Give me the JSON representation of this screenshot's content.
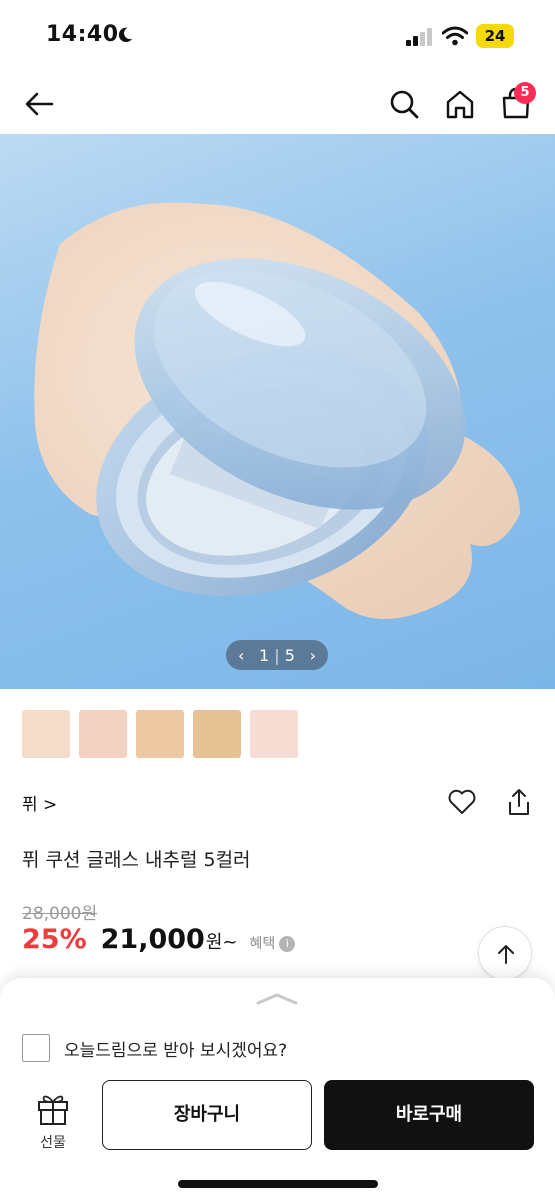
{
  "status_bar": {
    "time": "14:40",
    "battery": "24",
    "icons": [
      "moon-icon",
      "signal-icon",
      "wifi-icon",
      "battery-icon"
    ]
  },
  "nav": {
    "icons": [
      "back-arrow-icon",
      "search-icon",
      "home-icon",
      "shopping-bag-icon"
    ],
    "cart_count": "5"
  },
  "gallery": {
    "current": "1",
    "divider": "|",
    "total": "5",
    "prev_icon": "chevron-left-icon",
    "next_icon": "chevron-right-icon",
    "swatch_colors": [
      "#f4dcc9",
      "#f3d2c2",
      "#ecc9a2",
      "#e6c193",
      "#f6dcd3"
    ]
  },
  "product": {
    "brand": "퓌 >",
    "title": "퓌 쿠션 글래스 내추럴 5컬러",
    "original_price": "28,000원",
    "discount": "25%",
    "price": "21,000",
    "price_unit": "원~",
    "benefit_label": "혜택",
    "info_icon_glyph": "i"
  },
  "actions": {
    "icons": [
      "heart-icon",
      "share-icon",
      "arrow-up-icon"
    ]
  },
  "bottom_sheet": {
    "checkbox_label": "오늘드림으로 받아 보시겠어요?",
    "gift_label": "선물",
    "cart_button": "장바구니",
    "buy_button": "바로구매"
  },
  "colors": {
    "accent_red": "#ef3b3b",
    "badge": "#ff2d55",
    "primary_dark": "#111111"
  }
}
